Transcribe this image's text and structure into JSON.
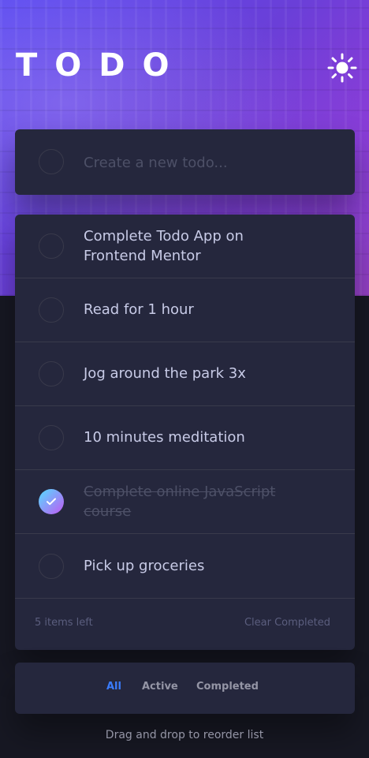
{
  "header": {
    "title": "TODO",
    "theme_toggle_icon": "sun-icon"
  },
  "new_todo": {
    "placeholder": "Create a new todo..."
  },
  "todos": [
    {
      "text": "Complete Todo App on Frontend Mentor",
      "completed": false
    },
    {
      "text": "Read for 1 hour",
      "completed": false
    },
    {
      "text": "Jog around the park 3x",
      "completed": false
    },
    {
      "text": "10 minutes meditation",
      "completed": false
    },
    {
      "text": "Complete online JavaScript course",
      "completed": true
    },
    {
      "text": "Pick up groceries",
      "completed": false
    }
  ],
  "list_footer": {
    "items_left": "5 items left",
    "clear_completed": "Clear Completed"
  },
  "filters": {
    "all": "All",
    "active": "Active",
    "completed": "Completed",
    "selected": "All"
  },
  "hint": "Drag and drop to reorder list",
  "colors": {
    "accent": "#3a7cfd",
    "card": "#25273d",
    "background": "#171823",
    "check_gradient_start": "#55ddff",
    "check_gradient_end": "#c058f3"
  }
}
